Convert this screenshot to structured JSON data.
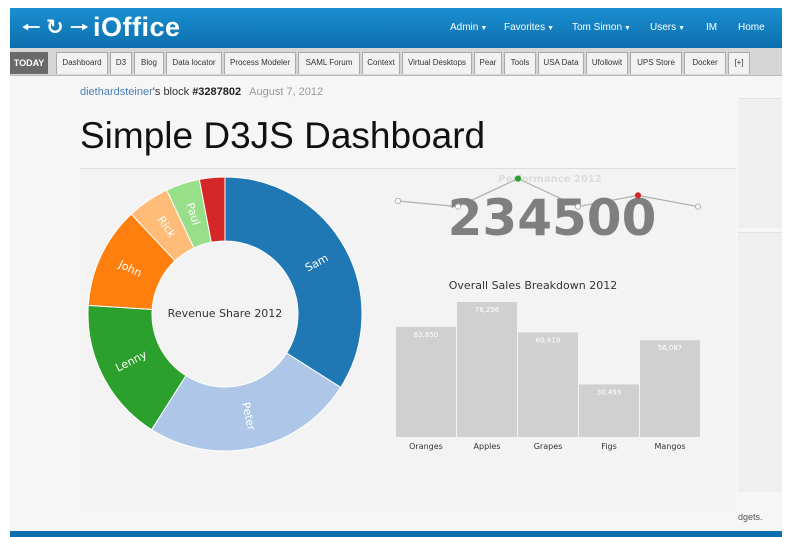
{
  "nav": {
    "back_icon": "left-arrow-icon",
    "refresh_icon": "refresh-icon",
    "forward_icon": "right-arrow-icon",
    "logo": "iOffice",
    "menu": [
      {
        "label": "Admin",
        "has_caret": true
      },
      {
        "label": "Favorites",
        "has_caret": true
      },
      {
        "label": "Tom Simon",
        "has_caret": true
      },
      {
        "label": "Users",
        "has_caret": true
      },
      {
        "label": "IM",
        "has_caret": false
      },
      {
        "label": "Home",
        "has_caret": false
      }
    ]
  },
  "tabs": {
    "today_label": "TODAY",
    "items": [
      "Dashboard",
      "D3",
      "Blog",
      "Data locator",
      "Process Modeler",
      "SAML Forum",
      "Context",
      "Virtual Desktops",
      "Pear",
      "Tools",
      "USA Data",
      "Ufollowit",
      "UPS Store",
      "Docker",
      "[+]"
    ]
  },
  "page": {
    "author": "diethardsteiner",
    "block_text": "'s block ",
    "block_number": "#3287802",
    "date": "August 7, 2012",
    "title": "Simple D3JS Dashboard",
    "footnote": "dgets."
  },
  "colors": {
    "brand": "#1a8fd0",
    "tabbar": "#d6d6d6",
    "big_number": "#7f7f7f",
    "bar": "#d0d0d0"
  },
  "chart_data": [
    {
      "type": "pie",
      "title": "Revenue Share 2012",
      "donut": true,
      "labels": [
        "Sam",
        "Peter",
        "Lenny",
        "John",
        "Rick",
        "Paul",
        ""
      ],
      "values": [
        34,
        25,
        17,
        12,
        5,
        4,
        3
      ],
      "colors": [
        "#1f77b4",
        "#aec7e8",
        "#2ca02c",
        "#ff7f0e",
        "#ffbb78",
        "#98df8a",
        "#d62728"
      ]
    },
    {
      "type": "line",
      "title": "Performance 2012",
      "big_number": "234500",
      "values": [
        5,
        4,
        9,
        4,
        6,
        4
      ],
      "ylim": [
        0,
        10
      ],
      "point_colors": [
        "#ffffff",
        "#ffffff",
        "#2ca02c",
        "#ffffff",
        "#d62728",
        "#ffffff"
      ]
    },
    {
      "type": "bar",
      "title": "Overall Sales Breakdown 2012",
      "categories": [
        "Oranges",
        "Apples",
        "Grapes",
        "Figs",
        "Mangos"
      ],
      "values": [
        63850,
        78258,
        60619,
        30493,
        56087
      ],
      "labels": [
        "63,850",
        "78,258",
        "60,619",
        "30,493",
        "56,087"
      ],
      "ylim": [
        0,
        80000
      ]
    }
  ]
}
